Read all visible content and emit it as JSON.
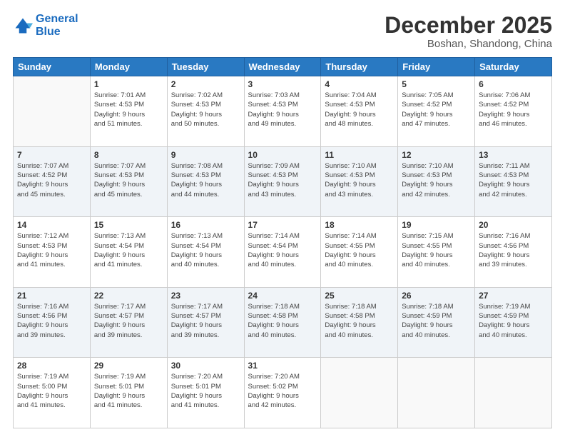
{
  "logo": {
    "line1": "General",
    "line2": "Blue"
  },
  "header": {
    "month_year": "December 2025",
    "location": "Boshan, Shandong, China"
  },
  "days_of_week": [
    "Sunday",
    "Monday",
    "Tuesday",
    "Wednesday",
    "Thursday",
    "Friday",
    "Saturday"
  ],
  "weeks": [
    [
      {
        "day": "",
        "info": ""
      },
      {
        "day": "1",
        "info": "Sunrise: 7:01 AM\nSunset: 4:53 PM\nDaylight: 9 hours\nand 51 minutes."
      },
      {
        "day": "2",
        "info": "Sunrise: 7:02 AM\nSunset: 4:53 PM\nDaylight: 9 hours\nand 50 minutes."
      },
      {
        "day": "3",
        "info": "Sunrise: 7:03 AM\nSunset: 4:53 PM\nDaylight: 9 hours\nand 49 minutes."
      },
      {
        "day": "4",
        "info": "Sunrise: 7:04 AM\nSunset: 4:53 PM\nDaylight: 9 hours\nand 48 minutes."
      },
      {
        "day": "5",
        "info": "Sunrise: 7:05 AM\nSunset: 4:52 PM\nDaylight: 9 hours\nand 47 minutes."
      },
      {
        "day": "6",
        "info": "Sunrise: 7:06 AM\nSunset: 4:52 PM\nDaylight: 9 hours\nand 46 minutes."
      }
    ],
    [
      {
        "day": "7",
        "info": "Sunrise: 7:07 AM\nSunset: 4:52 PM\nDaylight: 9 hours\nand 45 minutes."
      },
      {
        "day": "8",
        "info": "Sunrise: 7:07 AM\nSunset: 4:53 PM\nDaylight: 9 hours\nand 45 minutes."
      },
      {
        "day": "9",
        "info": "Sunrise: 7:08 AM\nSunset: 4:53 PM\nDaylight: 9 hours\nand 44 minutes."
      },
      {
        "day": "10",
        "info": "Sunrise: 7:09 AM\nSunset: 4:53 PM\nDaylight: 9 hours\nand 43 minutes."
      },
      {
        "day": "11",
        "info": "Sunrise: 7:10 AM\nSunset: 4:53 PM\nDaylight: 9 hours\nand 43 minutes."
      },
      {
        "day": "12",
        "info": "Sunrise: 7:10 AM\nSunset: 4:53 PM\nDaylight: 9 hours\nand 42 minutes."
      },
      {
        "day": "13",
        "info": "Sunrise: 7:11 AM\nSunset: 4:53 PM\nDaylight: 9 hours\nand 42 minutes."
      }
    ],
    [
      {
        "day": "14",
        "info": "Sunrise: 7:12 AM\nSunset: 4:53 PM\nDaylight: 9 hours\nand 41 minutes."
      },
      {
        "day": "15",
        "info": "Sunrise: 7:13 AM\nSunset: 4:54 PM\nDaylight: 9 hours\nand 41 minutes."
      },
      {
        "day": "16",
        "info": "Sunrise: 7:13 AM\nSunset: 4:54 PM\nDaylight: 9 hours\nand 40 minutes."
      },
      {
        "day": "17",
        "info": "Sunrise: 7:14 AM\nSunset: 4:54 PM\nDaylight: 9 hours\nand 40 minutes."
      },
      {
        "day": "18",
        "info": "Sunrise: 7:14 AM\nSunset: 4:55 PM\nDaylight: 9 hours\nand 40 minutes."
      },
      {
        "day": "19",
        "info": "Sunrise: 7:15 AM\nSunset: 4:55 PM\nDaylight: 9 hours\nand 40 minutes."
      },
      {
        "day": "20",
        "info": "Sunrise: 7:16 AM\nSunset: 4:56 PM\nDaylight: 9 hours\nand 39 minutes."
      }
    ],
    [
      {
        "day": "21",
        "info": "Sunrise: 7:16 AM\nSunset: 4:56 PM\nDaylight: 9 hours\nand 39 minutes."
      },
      {
        "day": "22",
        "info": "Sunrise: 7:17 AM\nSunset: 4:57 PM\nDaylight: 9 hours\nand 39 minutes."
      },
      {
        "day": "23",
        "info": "Sunrise: 7:17 AM\nSunset: 4:57 PM\nDaylight: 9 hours\nand 39 minutes."
      },
      {
        "day": "24",
        "info": "Sunrise: 7:18 AM\nSunset: 4:58 PM\nDaylight: 9 hours\nand 40 minutes."
      },
      {
        "day": "25",
        "info": "Sunrise: 7:18 AM\nSunset: 4:58 PM\nDaylight: 9 hours\nand 40 minutes."
      },
      {
        "day": "26",
        "info": "Sunrise: 7:18 AM\nSunset: 4:59 PM\nDaylight: 9 hours\nand 40 minutes."
      },
      {
        "day": "27",
        "info": "Sunrise: 7:19 AM\nSunset: 4:59 PM\nDaylight: 9 hours\nand 40 minutes."
      }
    ],
    [
      {
        "day": "28",
        "info": "Sunrise: 7:19 AM\nSunset: 5:00 PM\nDaylight: 9 hours\nand 41 minutes."
      },
      {
        "day": "29",
        "info": "Sunrise: 7:19 AM\nSunset: 5:01 PM\nDaylight: 9 hours\nand 41 minutes."
      },
      {
        "day": "30",
        "info": "Sunrise: 7:20 AM\nSunset: 5:01 PM\nDaylight: 9 hours\nand 41 minutes."
      },
      {
        "day": "31",
        "info": "Sunrise: 7:20 AM\nSunset: 5:02 PM\nDaylight: 9 hours\nand 42 minutes."
      },
      {
        "day": "",
        "info": ""
      },
      {
        "day": "",
        "info": ""
      },
      {
        "day": "",
        "info": ""
      }
    ]
  ]
}
